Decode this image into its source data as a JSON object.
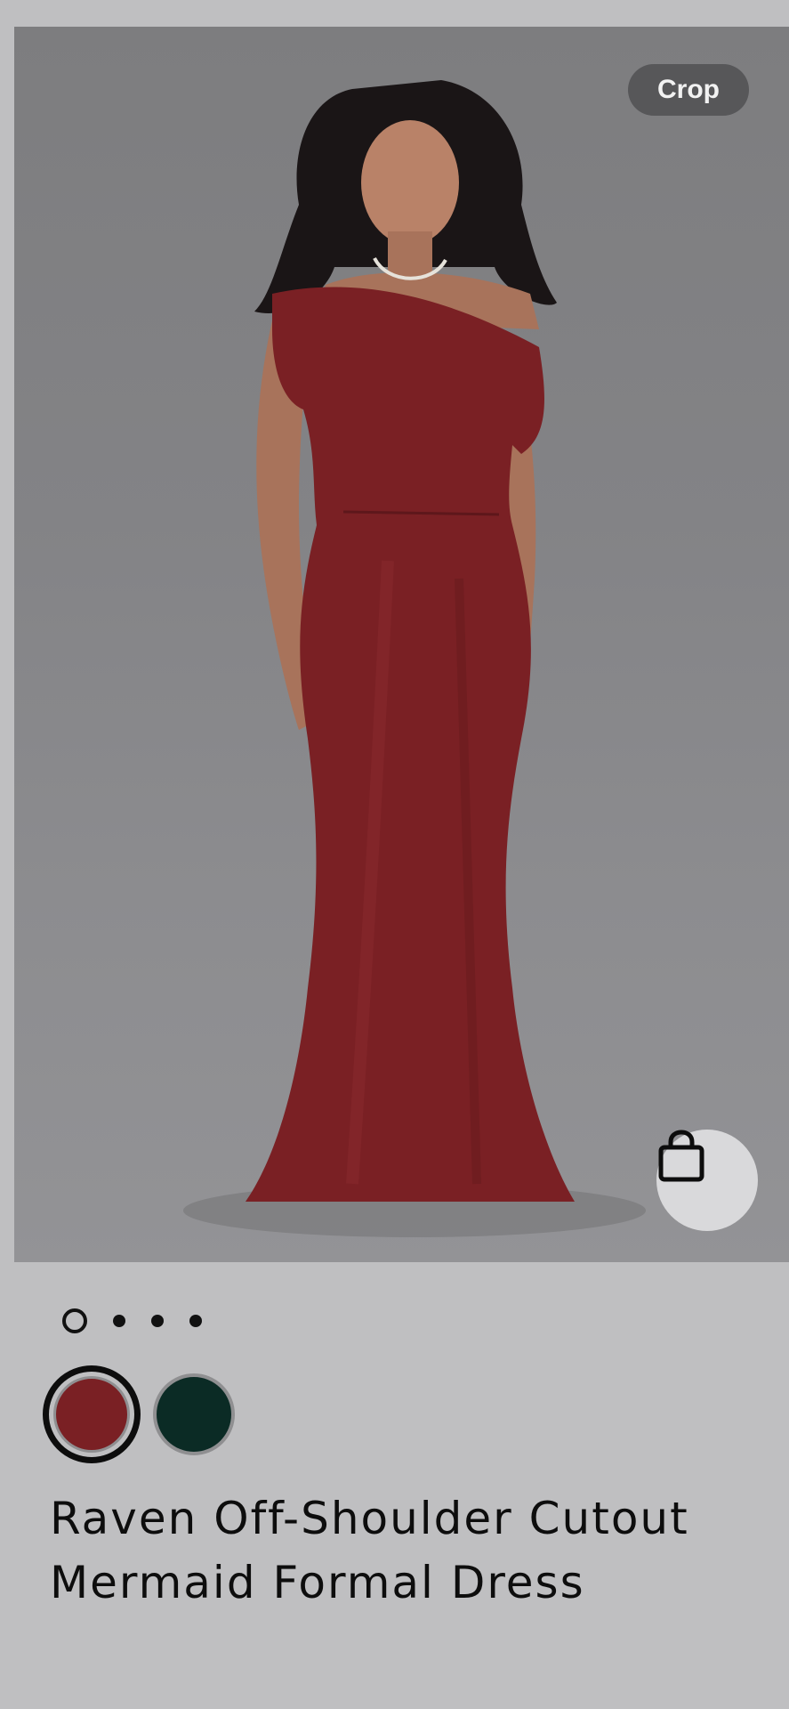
{
  "image": {
    "crop_label": "Crop",
    "image_icon": "dress-photo",
    "bag_icon": "shopping-bag-icon"
  },
  "carousel": {
    "dot_count": 4,
    "active_index": 0
  },
  "swatches": [
    {
      "color": "#7a2024",
      "selected": true
    },
    {
      "color": "#0b2b25",
      "selected": false
    }
  ],
  "product": {
    "title": "Raven Off-Shoulder Cutout Mermaid Formal Dress"
  }
}
